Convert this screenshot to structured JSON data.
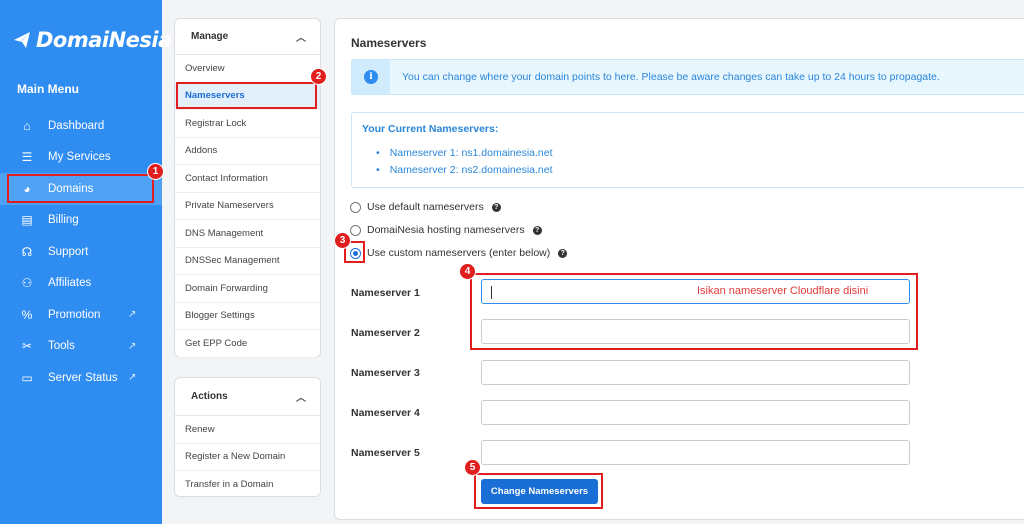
{
  "brand": {
    "name": "DomaiNesia"
  },
  "sidebar": {
    "title": "Main Menu",
    "items": [
      {
        "label": "Dashboard",
        "icon": "home-icon",
        "glyph": "⌂"
      },
      {
        "label": "My Services",
        "icon": "stack-icon",
        "glyph": "☰"
      },
      {
        "label": "Domains",
        "icon": "globe-icon",
        "glyph": "◕",
        "active": true
      },
      {
        "label": "Billing",
        "icon": "invoice-icon",
        "glyph": "▤"
      },
      {
        "label": "Support",
        "icon": "headset-icon",
        "glyph": "☊"
      },
      {
        "label": "Affiliates",
        "icon": "users-icon",
        "glyph": "⚇"
      },
      {
        "label": "Promotion",
        "icon": "percent-icon",
        "glyph": "%",
        "external": true
      },
      {
        "label": "Tools",
        "icon": "tools-icon",
        "glyph": "✂",
        "external": true
      },
      {
        "label": "Server Status",
        "icon": "monitor-icon",
        "glyph": "▭",
        "external": true
      }
    ]
  },
  "manage": {
    "title": "Manage",
    "items": [
      "Overview",
      "Nameservers",
      "Registrar Lock",
      "Addons",
      "Contact Information",
      "Private Nameservers",
      "DNS Management",
      "DNSSec Management",
      "Domain Forwarding",
      "Blogger Settings",
      "Get EPP Code"
    ],
    "active": "Nameservers"
  },
  "actions": {
    "title": "Actions",
    "items": [
      "Renew",
      "Register a New Domain",
      "Transfer in a Domain"
    ]
  },
  "main": {
    "title": "Nameservers",
    "alert": "You can change where your domain points to here. Please be aware changes can take up to 24 hours to propagate.",
    "current": {
      "title": "Your Current Nameservers:",
      "items": [
        "Nameserver 1: ns1.domainesia.net",
        "Nameserver 2: ns2.domainesia.net"
      ]
    },
    "options": [
      {
        "label": "Use default nameservers",
        "checked": false
      },
      {
        "label": "DomaiNesia hosting nameservers",
        "checked": false
      },
      {
        "label": "Use custom nameservers (enter below)",
        "checked": true
      }
    ],
    "nameservers": [
      {
        "label": "Nameserver 1",
        "value": ""
      },
      {
        "label": "Nameserver 2",
        "value": ""
      },
      {
        "label": "Nameserver 3",
        "value": ""
      },
      {
        "label": "Nameserver 4",
        "value": ""
      },
      {
        "label": "Nameserver 5",
        "value": ""
      }
    ],
    "hint": "Isikan nameserver Cloudflare disini",
    "submit": "Change Nameservers"
  },
  "annotations": [
    "1",
    "2",
    "3",
    "4",
    "5"
  ],
  "colors": {
    "sidebar": "#2f8cf0",
    "primary": "#1a6fd6",
    "annotation": "#e11e1e"
  }
}
